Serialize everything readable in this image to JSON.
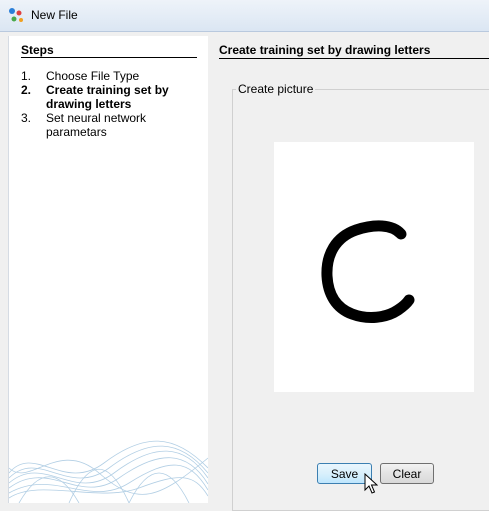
{
  "window": {
    "title": "New File",
    "icon": "app-icon"
  },
  "sidebar": {
    "heading": "Steps",
    "steps": [
      {
        "num": "1.",
        "label": "Choose File Type",
        "current": false
      },
      {
        "num": "2.",
        "label": "Create training set by drawing letters",
        "current": true
      },
      {
        "num": "3.",
        "label": "Set neural network parametars",
        "current": false
      }
    ]
  },
  "main": {
    "heading": "Create training set by drawing letters",
    "group_label": "Create picture",
    "drawing": {
      "letter_shape": "C",
      "stroke_color": "#000000"
    }
  },
  "buttons": {
    "save": "Save",
    "clear": "Clear"
  },
  "colors": {
    "title_bar": "#dbe6f3",
    "panel_bg": "#ffffff",
    "button_hover": "#bee6fd"
  }
}
